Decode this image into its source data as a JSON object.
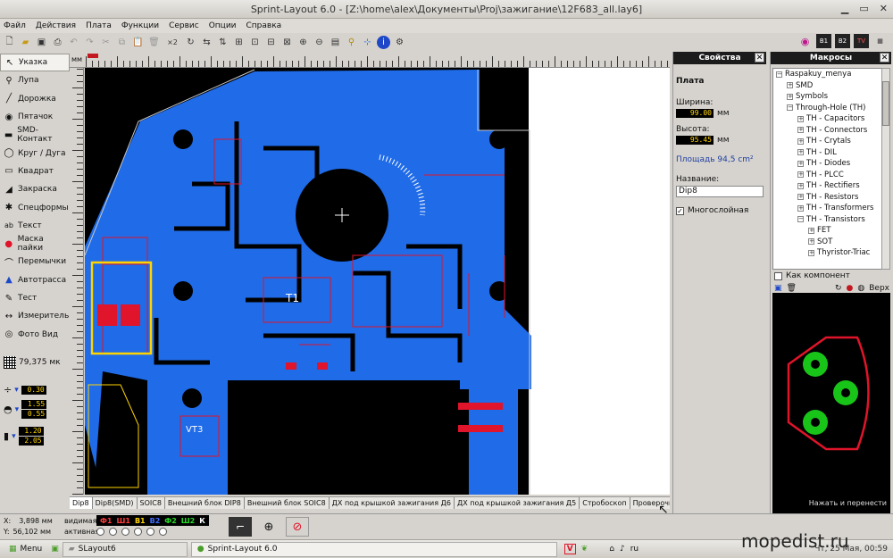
{
  "window": {
    "title": "Sprint-Layout 6.0 - [Z:\\home\\alex\\Документы\\Proj\\зажигание\\12F683_all.lay6]"
  },
  "menu": [
    "Файл",
    "Действия",
    "Плата",
    "Функции",
    "Сервис",
    "Опции",
    "Справка"
  ],
  "toolbar": {
    "copy_count": "×2"
  },
  "tools": [
    {
      "label": "Указка",
      "icon": "pointer-icon",
      "glyph": "↖"
    },
    {
      "label": "Лупа",
      "icon": "magnifier-icon",
      "glyph": "⚲"
    },
    {
      "label": "Дорожка",
      "icon": "track-icon",
      "glyph": "╱"
    },
    {
      "label": "Пятачок",
      "icon": "pad-icon",
      "glyph": "◉"
    },
    {
      "label": "SMD-Контакт",
      "icon": "smd-pad-icon",
      "glyph": "▬"
    },
    {
      "label": "Круг / Дуга",
      "icon": "circle-arc-icon",
      "glyph": "◯"
    },
    {
      "label": "Квадрат",
      "icon": "rectangle-icon",
      "glyph": "▭"
    },
    {
      "label": "Закраска",
      "icon": "fill-icon",
      "glyph": "◢"
    },
    {
      "label": "Спецформы",
      "icon": "special-shapes-icon",
      "glyph": "✱"
    },
    {
      "label": "Текст",
      "icon": "text-icon",
      "glyph": "ab"
    },
    {
      "label": "Маска пайки",
      "icon": "solder-mask-icon",
      "glyph": "●"
    },
    {
      "label": "Перемычки",
      "icon": "jumper-icon",
      "glyph": "⌒"
    },
    {
      "label": "Автотрасса",
      "icon": "autoroute-icon",
      "glyph": "▲"
    },
    {
      "label": "Тест",
      "icon": "test-icon",
      "glyph": "✎"
    },
    {
      "label": "Измеритель",
      "icon": "measure-icon",
      "glyph": "↔"
    },
    {
      "label": "Фото Вид",
      "icon": "photo-view-icon",
      "glyph": "◎"
    }
  ],
  "grid": {
    "value": "79,375 мк"
  },
  "params": {
    "track_width": "0.30",
    "pad_outer": "1.55",
    "pad_inner": "0.55",
    "smd_w": "1.20",
    "smd_h": "2.05"
  },
  "ruler": {
    "unit": "мм"
  },
  "board_text": {
    "comp1": "T1",
    "comp2": "VT3"
  },
  "tabs": [
    "Dip8",
    "Dip8(SMD)",
    "SOIC8",
    "Внешний блок DIP8",
    "Внешний блок SOIC8",
    "ДХ под крышкой зажигания Д6",
    "ДХ под крышкой зажигания Д5",
    "Стробоскоп",
    "Проверочн"
  ],
  "properties": {
    "header": "Свойства",
    "section": "Плата",
    "width_label": "Ширина:",
    "width_value": "99.00",
    "height_label": "Высота:",
    "height_value": "95.45",
    "unit": "мм",
    "area_label": "Площадь",
    "area_value": "94,5 cm²",
    "name_label": "Название:",
    "name_value": "Dip8",
    "multilayer_label": "Многослойная",
    "multilayer_checked": true
  },
  "macros": {
    "header": "Макросы",
    "tree": [
      {
        "label": "Raspakuy_menya",
        "level": 0,
        "sign": "−"
      },
      {
        "label": "SMD",
        "level": 1,
        "sign": "+"
      },
      {
        "label": "Symbols",
        "level": 1,
        "sign": "+"
      },
      {
        "label": "Through-Hole (TH)",
        "level": 1,
        "sign": "−"
      },
      {
        "label": "TH - Capacitors",
        "level": 2,
        "sign": "+"
      },
      {
        "label": "TH - Connectors",
        "level": 2,
        "sign": "+"
      },
      {
        "label": "TH - Crytals",
        "level": 2,
        "sign": "+"
      },
      {
        "label": "TH - DIL",
        "level": 2,
        "sign": "+"
      },
      {
        "label": "TH - Diodes",
        "level": 2,
        "sign": "+"
      },
      {
        "label": "TH - PLCC",
        "level": 2,
        "sign": "+"
      },
      {
        "label": "TH - Rectifiers",
        "level": 2,
        "sign": "+"
      },
      {
        "label": "TH - Resistors",
        "level": 2,
        "sign": "+"
      },
      {
        "label": "TH - Transformers",
        "level": 2,
        "sign": "+"
      },
      {
        "label": "TH - Transistors",
        "level": 2,
        "sign": "−"
      },
      {
        "label": "FET",
        "level": 3,
        "sign": "+"
      },
      {
        "label": "SOT",
        "level": 3,
        "sign": "+"
      },
      {
        "label": "Thyristor-Triac",
        "level": 3,
        "sign": "+"
      }
    ],
    "as_component": "Как компонент",
    "top_label": "Верх",
    "hint": "Нажать и перенести"
  },
  "status": {
    "x_label": "X:",
    "x_value": "3,898 мм",
    "y_label": "Y:",
    "y_value": "56,102 мм",
    "visible_label": "видимая",
    "active_label": "активная",
    "layers": [
      {
        "name": "Ф1",
        "color": "#ff3b3b"
      },
      {
        "name": "Ш1",
        "color": "#ff3b3b"
      },
      {
        "name": "В1",
        "color": "#ffd400"
      },
      {
        "name": "В2",
        "color": "#3f6bff"
      },
      {
        "name": "Ф2",
        "color": "#27d927"
      },
      {
        "name": "Ш2",
        "color": "#27d927"
      },
      {
        "name": "К",
        "color": "#ffffff"
      }
    ]
  },
  "taskbar": {
    "menu": "Menu",
    "tasks": [
      "SLayout6",
      "Sprint-Layout 6.0"
    ],
    "locale": "ru",
    "clock": "Чт, 25 Мая, 00:59"
  },
  "watermark": "mopedist.ru",
  "colors": {
    "board_bg": "#000000",
    "copper": "#1f6be8",
    "silk": "#e0142a",
    "pad_green": "#19c419"
  }
}
